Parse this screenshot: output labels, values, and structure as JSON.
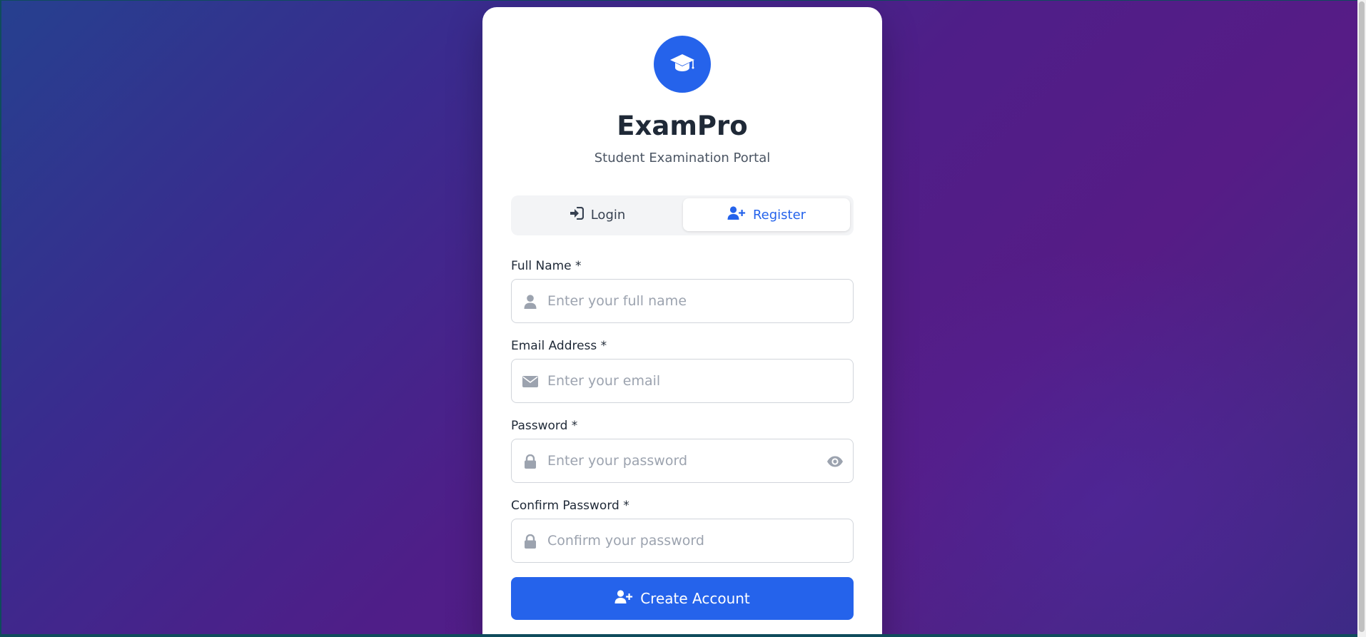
{
  "app": {
    "name": "ExamPro",
    "subtitle": "Student Examination Portal"
  },
  "tabs": [
    {
      "label": "Login",
      "icon": "sign-in-icon",
      "active": false
    },
    {
      "label": "Register",
      "icon": "user-plus-icon",
      "active": true
    }
  ],
  "form": {
    "full_name": {
      "label": "Full Name *",
      "placeholder": "Enter your full name",
      "value": "",
      "icon": "user-icon"
    },
    "email": {
      "label": "Email Address *",
      "placeholder": "Enter your email",
      "value": "",
      "icon": "envelope-icon"
    },
    "password": {
      "label": "Password *",
      "placeholder": "Enter your password",
      "value": "",
      "icon": "lock-icon"
    },
    "confirm_password": {
      "label": "Confirm Password *",
      "placeholder": "Confirm your password",
      "value": "",
      "icon": "lock-icon"
    },
    "submit_label": "Create Account"
  },
  "colors": {
    "accent": "#2563eb",
    "text": "#1f2937",
    "muted": "#9ca3af",
    "background_start": "#26408f",
    "background_end": "#561c86"
  }
}
